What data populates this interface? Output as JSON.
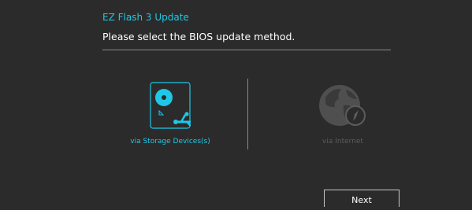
{
  "dialog": {
    "title": "EZ Flash 3 Update",
    "prompt": "Please select the BIOS update method."
  },
  "options": [
    {
      "label": "via Storage Devices(s)",
      "icon": "storage-usb-icon",
      "state": "selected",
      "color": "#1ec8e6"
    },
    {
      "label": "via Internet",
      "icon": "globe-compass-icon",
      "state": "disabled",
      "color": "#5c5c5c"
    }
  ],
  "footer": {
    "next_label": "Next"
  },
  "colors": {
    "background": "#2b2b2b",
    "accent": "#1ec8e6",
    "text": "#ffffff",
    "disabled": "#5c5c5c"
  }
}
